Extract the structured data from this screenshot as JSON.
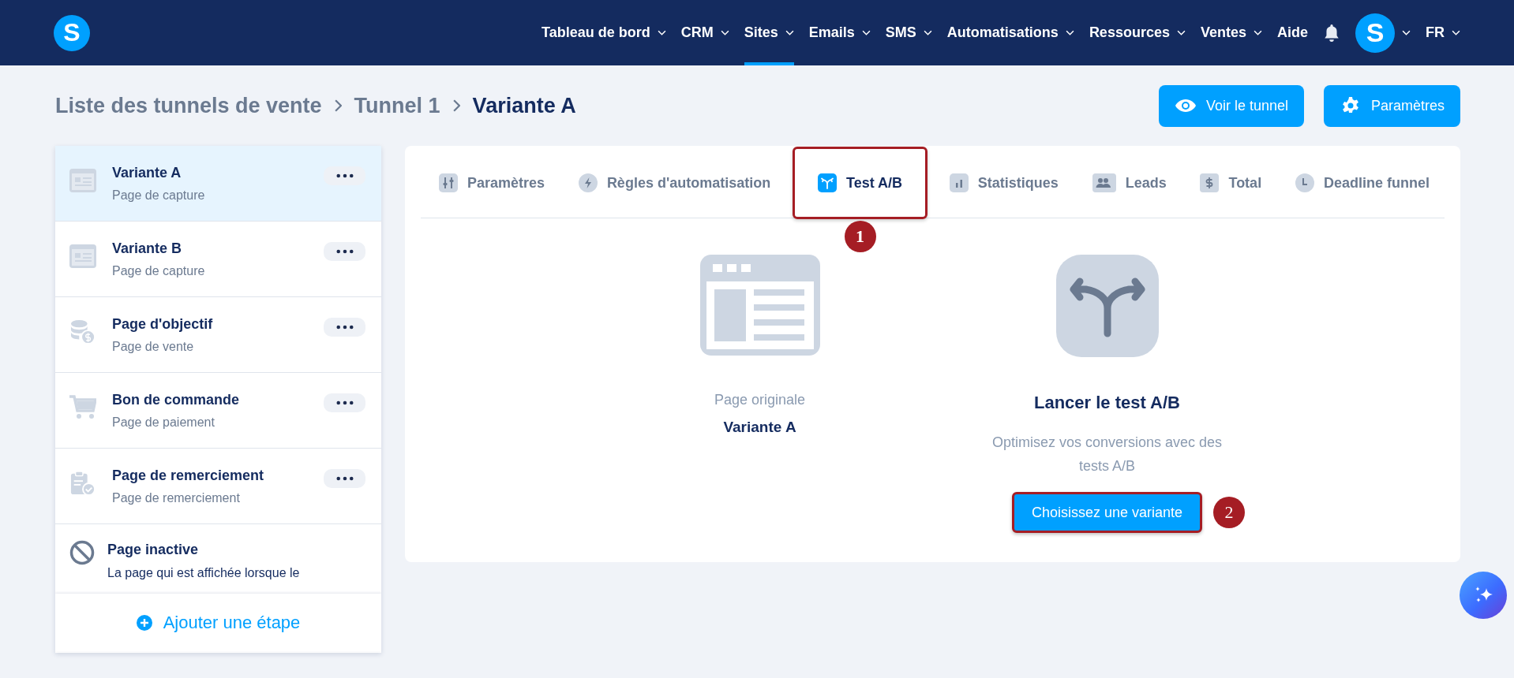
{
  "header": {
    "logo": "S",
    "nav": [
      {
        "label": "Tableau de bord",
        "caret": true,
        "selected": false
      },
      {
        "label": "CRM",
        "caret": true,
        "selected": false
      },
      {
        "label": "Sites",
        "caret": true,
        "selected": true
      },
      {
        "label": "Emails",
        "caret": true,
        "selected": false
      },
      {
        "label": "SMS",
        "caret": true,
        "selected": false
      },
      {
        "label": "Automatisations",
        "caret": true,
        "selected": false
      },
      {
        "label": "Ressources",
        "caret": true,
        "selected": false
      },
      {
        "label": "Ventes",
        "caret": true,
        "selected": false
      },
      {
        "label": "Aide",
        "caret": false,
        "selected": false
      }
    ],
    "avatar": "S",
    "language": "FR"
  },
  "breadcrumb": [
    "Liste des tunnels de vente",
    "Tunnel 1",
    "Variante A"
  ],
  "actions": [
    {
      "label": "Voir le tunnel",
      "kind": "eye"
    },
    {
      "label": "Paramètres",
      "kind": "gear"
    }
  ],
  "sidebar": {
    "steps": [
      {
        "title": "Variante A",
        "subtitle": "Page de capture",
        "kind": "form",
        "selected": true
      },
      {
        "title": "Variante B",
        "subtitle": "Page de capture",
        "kind": "form",
        "selected": false
      },
      {
        "title": "Page d'objectif",
        "subtitle": "Page de vente",
        "kind": "coins",
        "selected": false
      },
      {
        "title": "Bon de commande",
        "subtitle": "Page de paiement",
        "kind": "cart",
        "selected": false
      },
      {
        "title": "Page de remerciement",
        "subtitle": "Page de remerciement",
        "kind": "clipboard",
        "selected": false
      }
    ],
    "inactive": {
      "title": "Page inactive",
      "description": "La page qui est affichée lorsque le"
    },
    "add_step": "Ajouter une étape"
  },
  "tabs": [
    {
      "label": "Paramètres",
      "kind": "sliders",
      "selected": false,
      "highlighted": false
    },
    {
      "label": "Règles d'automatisation",
      "kind": "bolt",
      "selected": false,
      "highlighted": false
    },
    {
      "label": "Test A/B",
      "kind": "fork",
      "selected": true,
      "highlighted": true,
      "marker": "1"
    },
    {
      "label": "Statistiques",
      "kind": "bars",
      "selected": false,
      "highlighted": false
    },
    {
      "label": "Leads",
      "kind": "people",
      "selected": false,
      "highlighted": false
    },
    {
      "label": "Total",
      "kind": "dollar",
      "selected": false,
      "highlighted": false
    },
    {
      "label": "Deadline funnel",
      "kind": "clock",
      "selected": false,
      "highlighted": false
    }
  ],
  "original": {
    "caption": "Page originale",
    "name": "Variante A"
  },
  "ab_test": {
    "title": "Lancer le test A/B",
    "description": "Optimisez vos conversions avec des tests A/B",
    "button": {
      "label": "Choisissez une variante",
      "highlighted": true,
      "marker": "2"
    }
  }
}
